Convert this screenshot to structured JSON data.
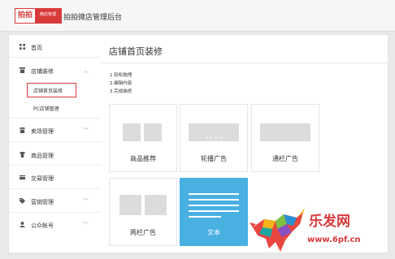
{
  "header": {
    "logo_mark": "拍拍",
    "logo_tag": "微店管理",
    "title": "拍拍微店管理后台"
  },
  "sidebar": {
    "items": [
      {
        "label": "首页",
        "icon": "grid-icon"
      },
      {
        "label": "店铺装修",
        "icon": "store-icon",
        "expanded": true
      },
      {
        "label": "卖场管理",
        "icon": "shop-icon"
      },
      {
        "label": "商品管理",
        "icon": "shirt-icon"
      },
      {
        "label": "交易管理",
        "icon": "card-icon"
      },
      {
        "label": "营销管理",
        "icon": "tag-icon"
      },
      {
        "label": "公众帐号",
        "icon": "user-icon"
      }
    ],
    "subitems": [
      {
        "label": "店铺首页装修",
        "selected": true
      },
      {
        "label": "PC店铺管理"
      }
    ]
  },
  "main": {
    "title": "店铺首页装修",
    "steps": [
      "1.轻松拖拽",
      "2.编辑内容",
      "3.完成装修"
    ],
    "modules": [
      {
        "label": "商品推荐"
      },
      {
        "label": "轮播广告"
      },
      {
        "label": "通栏广告"
      },
      {
        "label": "两栏广告"
      },
      {
        "label": "文本",
        "active": true
      }
    ]
  },
  "watermark": {
    "text": "乐发网",
    "url": "www.6pf.cn"
  },
  "colors": {
    "accent_red": "#d8393b",
    "active_blue": "#49b0e2"
  }
}
